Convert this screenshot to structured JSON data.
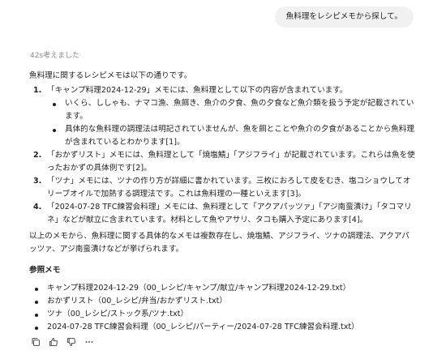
{
  "user_message": "魚料理をレシピメモから探して。",
  "thought_time": "42s考えました",
  "answer": {
    "intro": "魚料理に関するレシピメモは以下の通りです。",
    "items": [
      {
        "num": "1.",
        "text": "「キャンプ料理2024-12-29」メモには、魚料理として以下の内容が含まれています。",
        "sub": [
          "いくら、ししゃも、ナマコ漁、魚餌き、魚介の夕食、魚の夕食など魚介類を扱う予定が記載されています。",
          "具体的な魚料理の調理法は明記されていませんが、魚を餌とことや魚介の夕食があることから魚料理が含まれているとわかります[1]。"
        ]
      },
      {
        "num": "2.",
        "text": "「おかずリスト」メモには、魚料理として「焼塩鯖」「アジフライ」が記載されています。これらは魚を使ったおかずの具体例です[2]。",
        "sub": []
      },
      {
        "num": "3.",
        "text": "「ツナ」メモには、ツナの作り方が詳細に書かれています。三枚におろして皮をむき、塩コショウしてオリーブオイルで加熱する調理法です。これは魚料理の一種といえます[3]。",
        "sub": []
      },
      {
        "num": "4.",
        "text": "「2024-07-28 TFC練習会料理」メモには、魚料理として「アクアパッツァ」「アジ南蛮漬け」「タコマリネ」などが献立に含まれています。材料として魚やアサリ、タコも購入予定にあります[4]。",
        "sub": []
      }
    ],
    "summary": "以上のメモから、魚料理に関する具体的なメモは複数存在し、焼塩鯖、アジフライ、ツナの調理法、アクアパッツァ、アジ南蛮漬けなどが挙げられます。",
    "refs_title": "参照メモ",
    "refs": [
      "キャンプ料理2024-12-29（00_レシピ/キャンプ/献立/キャンプ料理2024-12-29.txt）",
      "おかずリスト（00_レシピ/弁当/おかずリスト.txt）",
      "ツナ（00_レシピ/ストック系/ツナ.txt）",
      "2024-07-28 TFC練習会料理（00_レシピ/パーティー/2024-07-28 TFC練習会料理.txt）"
    ]
  },
  "actions": [
    {
      "icon": "copy-icon"
    },
    {
      "icon": "thumbs-up-icon"
    },
    {
      "icon": "thumbs-down-icon"
    },
    {
      "icon": "more-icon"
    }
  ]
}
